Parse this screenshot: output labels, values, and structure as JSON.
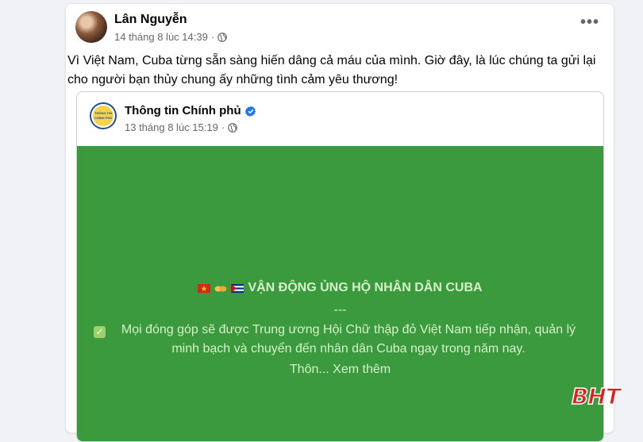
{
  "post": {
    "author": "Lân Nguyễn",
    "timestamp": "14 tháng 8 lúc 14:39",
    "text": "Vì Việt Nam, Cuba từng sẵn sàng hiến dâng cả máu của mình. Giờ đây, là lúc chúng ta gửi lại cho người bạn thủy chung ấy những tình cảm yêu thương!",
    "more_label": "•••"
  },
  "shared_post": {
    "page_name": "Thông tin Chính phủ",
    "timestamp": "13 tháng 8 lúc 15:19",
    "logo_text": "THÔNG TIN CHÍNH PHỦ",
    "title": "VẬN ĐỘNG ỦNG HỘ NHÂN DÂN CUBA",
    "divider": "---",
    "body": "Mọi đóng góp sẽ được Trung ương Hội Chữ thập đỏ Việt Nam tiếp nhận, quản lý minh bạch và chuyển đến nhân dân Cuba ngay trong năm nay.",
    "truncated": "Thôn...",
    "see_more": "Xem thêm",
    "background_color": "#3a9a3d"
  },
  "watermark": "BHT"
}
